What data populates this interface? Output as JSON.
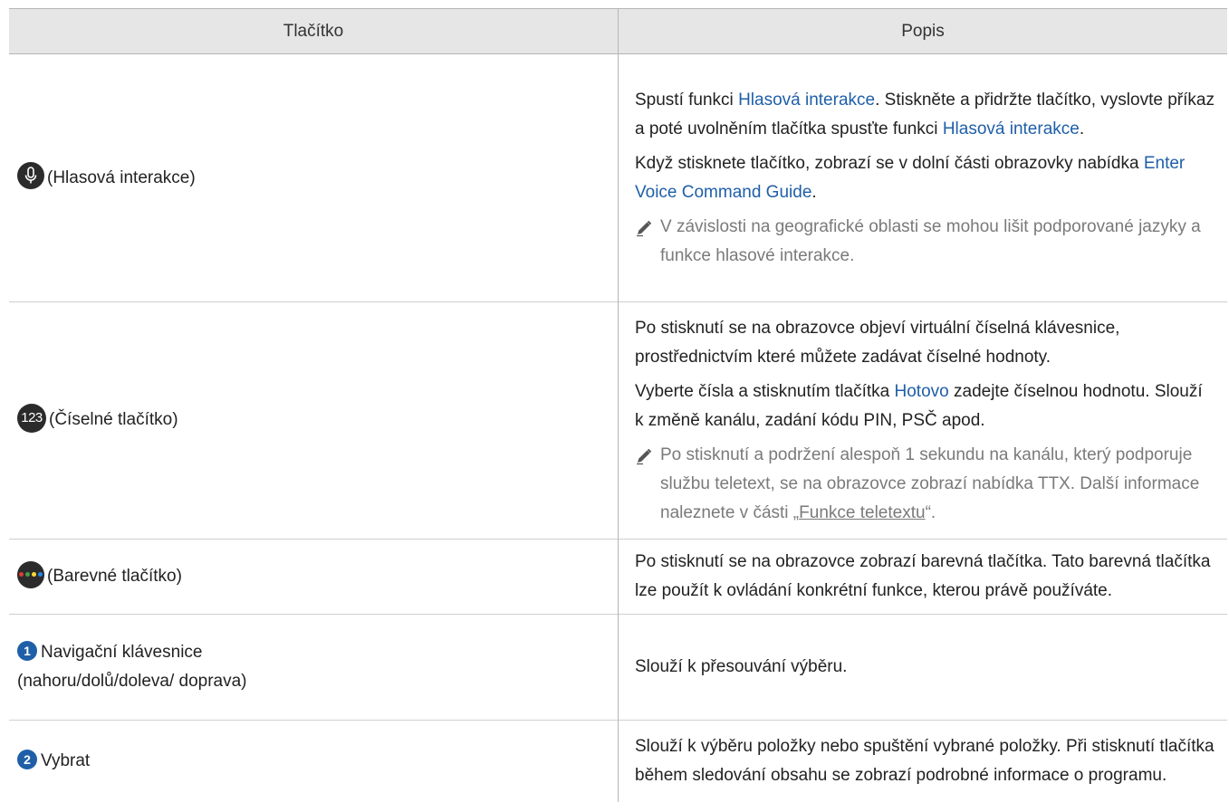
{
  "header": {
    "col1": "Tlačítko",
    "col2": "Popis"
  },
  "colors": {
    "header_bg": "#e6e6e6",
    "link": "#1f5fa8",
    "note": "#7a7a7a",
    "icon_bg": "#2b2b2b",
    "dot_red": "#e53935",
    "dot_green": "#43a047",
    "dot_yellow": "#fdd835",
    "dot_blue": "#1e88e5"
  },
  "rows": [
    {
      "icon": "microphone-icon",
      "label": "(Hlasová interakce)",
      "p1": {
        "a": "Spustí funkci ",
        "b": "Hlasová interakce",
        "c": ". Stiskněte a přidržte tlačítko, vyslovte příkaz a poté uvolněním tlačítka spusťte funkci ",
        "d": "Hlasová interakce",
        "e": "."
      },
      "p2": {
        "a": "Když stisknete tlačítko, zobrazí se v dolní části obrazovky nabídka ",
        "b": "Enter Voice Command Guide",
        "c": "."
      },
      "note": "V závislosti na geografické oblasti se mohou lišit podporované jazyky a funkce hlasové interakce."
    },
    {
      "icon": "123",
      "label": "(Číselné tlačítko)",
      "p1": "Po stisknutí se na obrazovce objeví virtuální číselná klávesnice, prostřednictvím které můžete zadávat číselné hodnoty.",
      "p2": {
        "a": "Vyberte čísla a stisknutím tlačítka ",
        "b": "Hotovo",
        "c": " zadejte číselnou hodnotu. Slouží k změně kanálu, zadání kódu PIN, PSČ apod."
      },
      "note": {
        "a": "Po stisknutí a podržení alespoň 1 sekundu na kanálu, který podporuje službu teletext, se na obrazovce zobrazí nabídka TTX. Další informace naleznete v části „",
        "b": "Funkce teletextu",
        "c": "“."
      }
    },
    {
      "icon": "color-buttons-icon",
      "label": "(Barevné tlačítko)",
      "p1": "Po stisknutí se na obrazovce zobrazí barevná tlačítka. Tato barevná tlačítka lze použít k ovládání konkrétní funkce, kterou právě používáte."
    },
    {
      "num": "1",
      "label": "Navigační klávesnice (nahoru/dolů/doleva/ doprava)",
      "p1": "Slouží k přesouvání výběru."
    },
    {
      "num": "2",
      "label": "Vybrat",
      "p1": "Slouží k výběru položky nebo spuštění vybrané položky. Při stisknutí tlačítka během sledování obsahu se zobrazí podrobné informace o programu."
    }
  ]
}
